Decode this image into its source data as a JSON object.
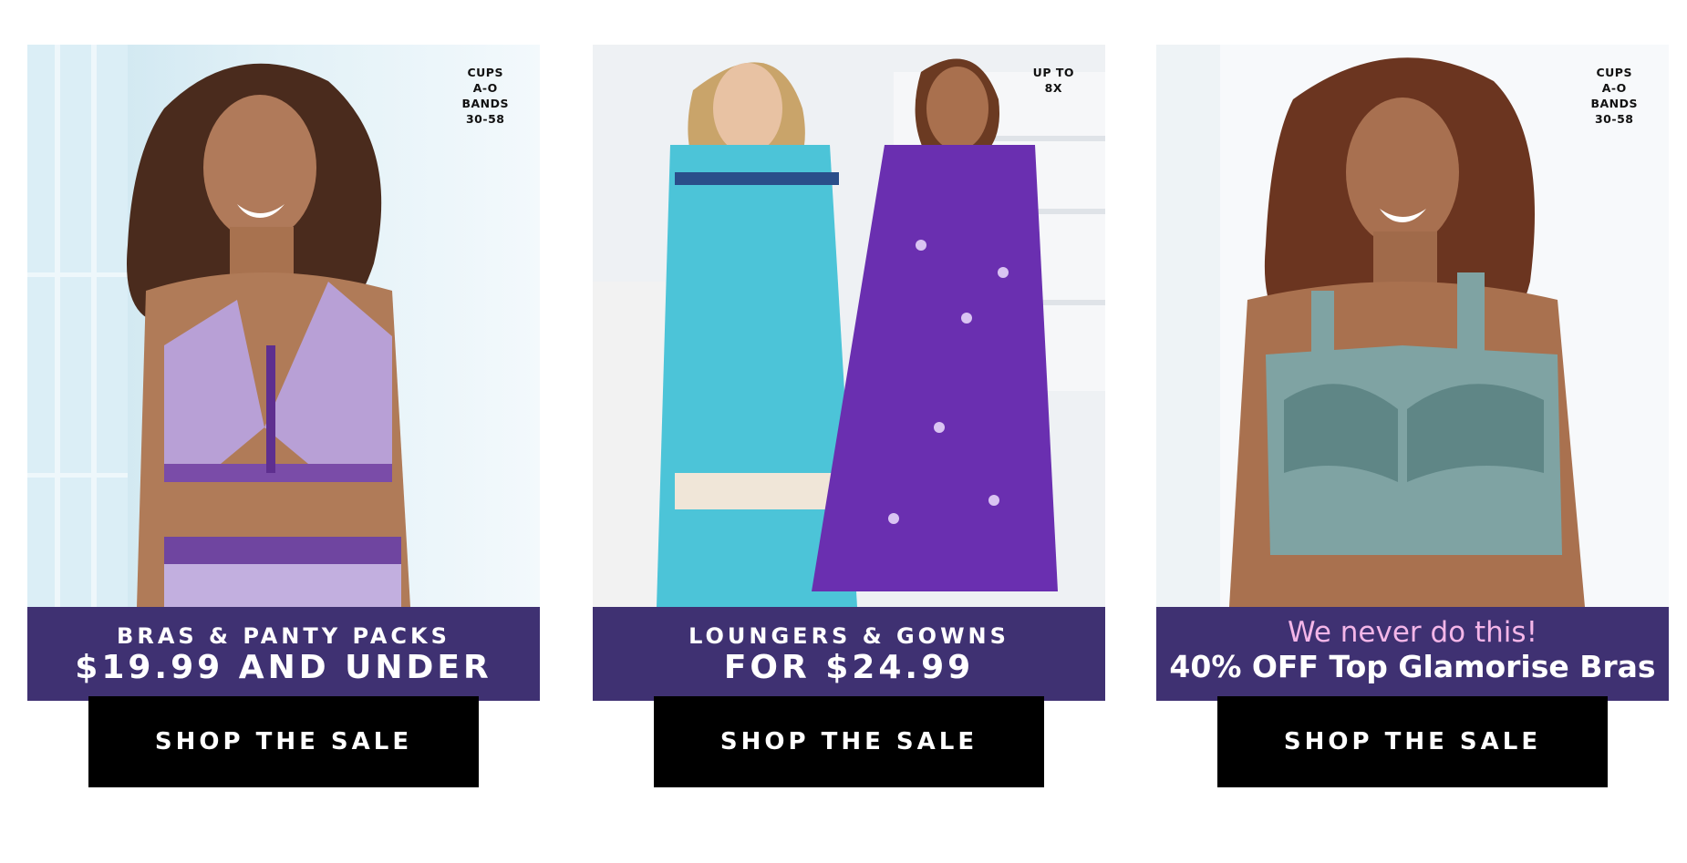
{
  "cards": [
    {
      "badge": [
        "CUPS",
        "A-O",
        "BANDS",
        "30-58"
      ],
      "banner_line1": "BRAS & PANTY PACKS",
      "banner_line2": "$19.99 AND UNDER",
      "button_label": "SHOP THE SALE",
      "image_subject": "model-in-purple-bra-and-panty-set"
    },
    {
      "badge": [
        "UP TO",
        "8X"
      ],
      "banner_line1": "LOUNGERS & GOWNS",
      "banner_line2": "FOR $24.99",
      "button_label": "SHOP THE SALE",
      "image_subject": "two-models-in-long-loungers"
    },
    {
      "badge": [
        "CUPS",
        "A-O",
        "BANDS",
        "30-58"
      ],
      "banner_line1": "We never do this!",
      "banner_line2": "40% OFF Top Glamorise Bras",
      "button_label": "SHOP THE SALE",
      "image_subject": "model-in-sage-lace-bra"
    }
  ],
  "colors": {
    "banner": "#3f3172",
    "promo_accent": "#f4b6e8",
    "button": "#000000"
  }
}
